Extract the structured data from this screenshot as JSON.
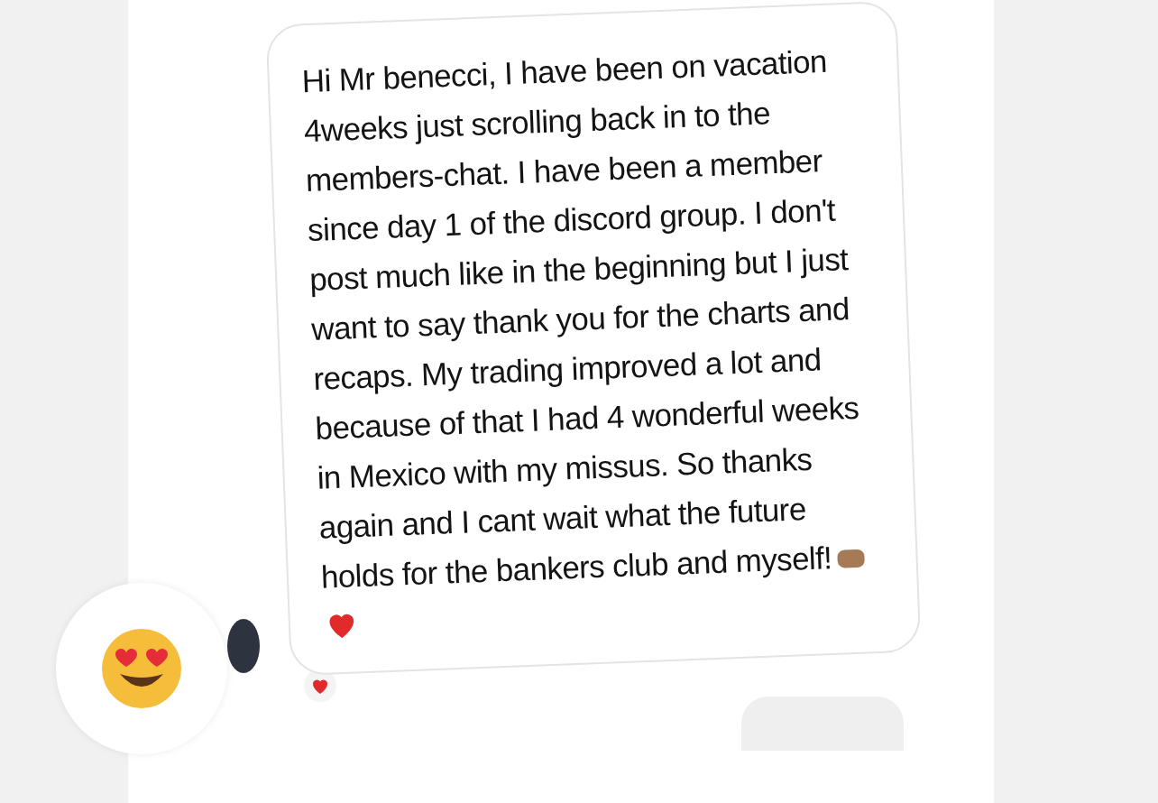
{
  "message": {
    "text": "Hi Mr benecci, I have been on vacation 4weeks just scrolling back in to the members-chat. I have been a member since day 1 of the discord group. I don't post much like in the beginning but I just want to say thank you for the charts and recaps. My trading improved a lot and because of that I had 4 wonderful weeks in Mexico with my missus. So thanks again and I cant wait what the future holds for the bankers club and myself!",
    "reacted": true
  }
}
